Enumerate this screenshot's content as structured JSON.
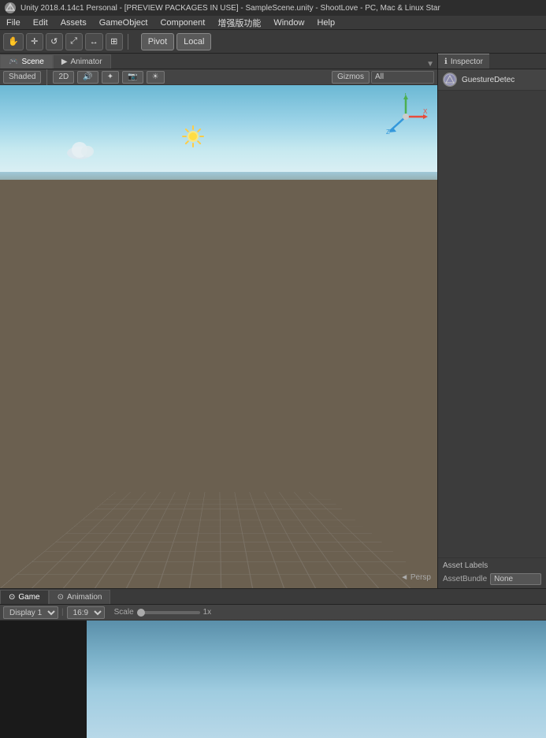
{
  "titleBar": {
    "text": "Unity 2018.4.14c1 Personal - [PREVIEW PACKAGES IN USE] - SampleScene.unity - ShootLove - PC, Mac & Linux Star",
    "logo": "U"
  },
  "menuBar": {
    "items": [
      "File",
      "Edit",
      "Assets",
      "GameObject",
      "Component",
      "增强版功能",
      "Window",
      "Help"
    ]
  },
  "toolbar": {
    "tools": [
      "✋",
      "✛",
      "↺",
      "⤢",
      "↔",
      "⊞"
    ],
    "pivot": "Pivot",
    "local": "Local"
  },
  "sceneTabs": {
    "tabs": [
      {
        "label": "Scene",
        "icon": "🎮",
        "active": true
      },
      {
        "label": "Animator",
        "icon": "▶",
        "active": false
      }
    ]
  },
  "sceneOptionsBar": {
    "shaded": "Shaded",
    "twoD": "2D",
    "gizmos": "Gizmos",
    "searchPlaceholder": "All"
  },
  "viewport": {
    "perspective": "◄ Persp"
  },
  "inspectorPanel": {
    "title": "Inspector",
    "objectName": "GuestureDetec",
    "assetLabels": "Asset Labels",
    "assetBundle": "AssetBundle",
    "noneLabel": "None"
  },
  "bottomPanel": {
    "tabs": [
      {
        "label": "Game",
        "icon": "⊙",
        "active": true
      },
      {
        "label": "Animation",
        "icon": "⊙",
        "active": false
      }
    ],
    "displayLabel": "Display 1",
    "ratioLabel": "16:9",
    "scaleLabel": "Scale",
    "scaleValue": "1x"
  }
}
